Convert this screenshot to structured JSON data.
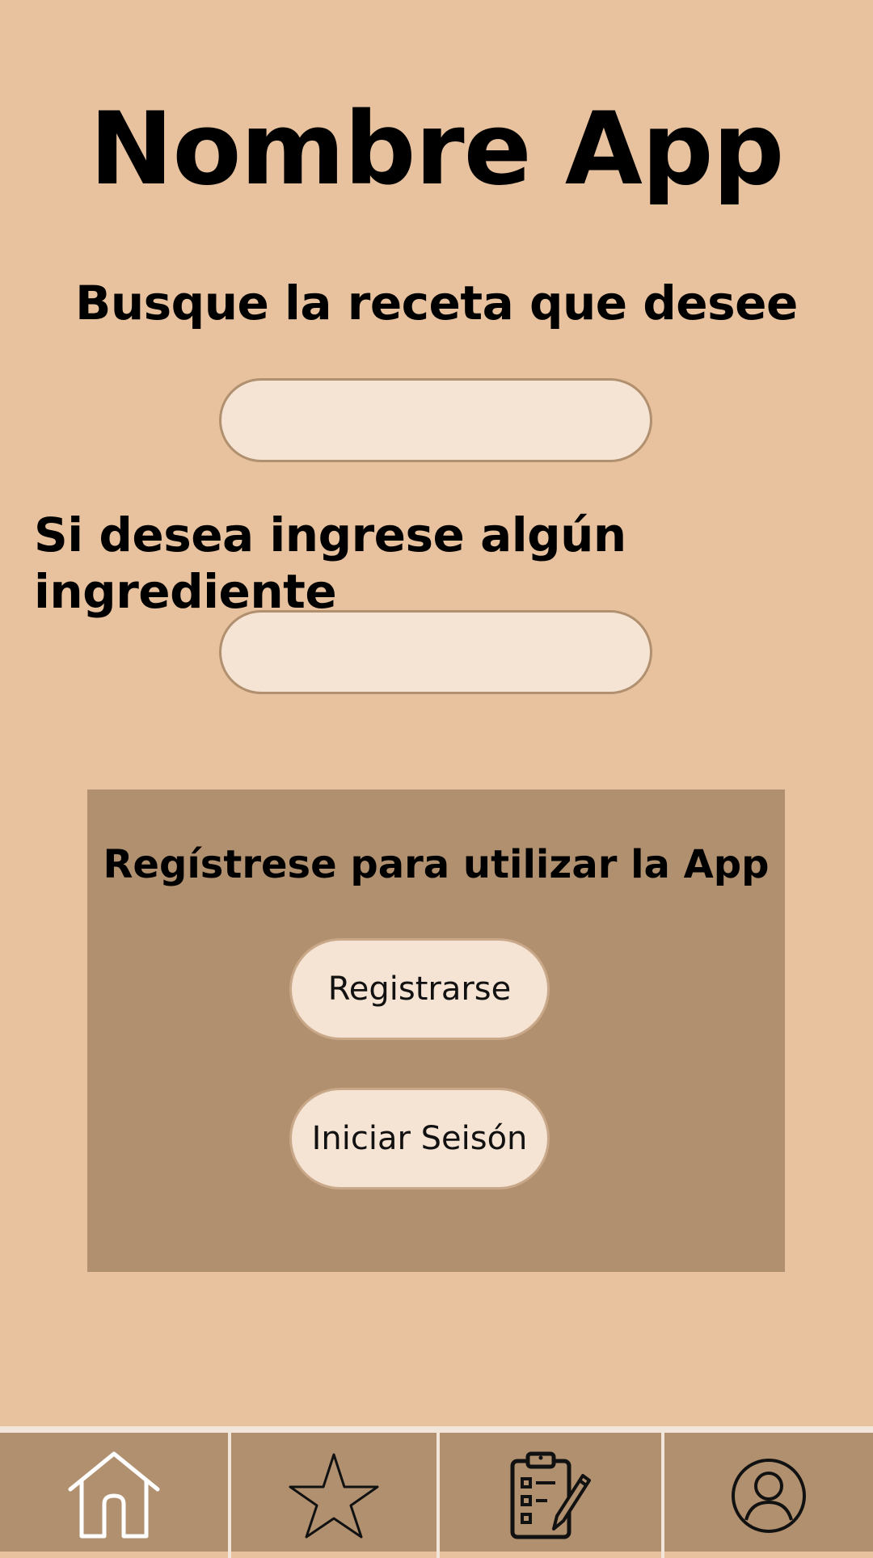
{
  "app": {
    "title": "Nombre App"
  },
  "search": {
    "heading": "Busque la receta que desee",
    "value": "",
    "placeholder": ""
  },
  "ingredient": {
    "heading": "Si desea ingrese algún ingrediente",
    "value": "",
    "placeholder": ""
  },
  "register_panel": {
    "title": "Regístrese para utilizar la App",
    "register_label": "Registrarse",
    "login_label": "Iniciar Seisón"
  },
  "nav": {
    "items": [
      {
        "icon": "home-icon"
      },
      {
        "icon": "star-icon"
      },
      {
        "icon": "clipboard-edit-icon"
      },
      {
        "icon": "user-profile-icon"
      }
    ]
  },
  "colors": {
    "background": "#e8c29e",
    "panel": "#b0906f",
    "input_fill": "#f5e3d4",
    "input_border": "#b0906f",
    "nav_divider": "#f2e6da"
  }
}
